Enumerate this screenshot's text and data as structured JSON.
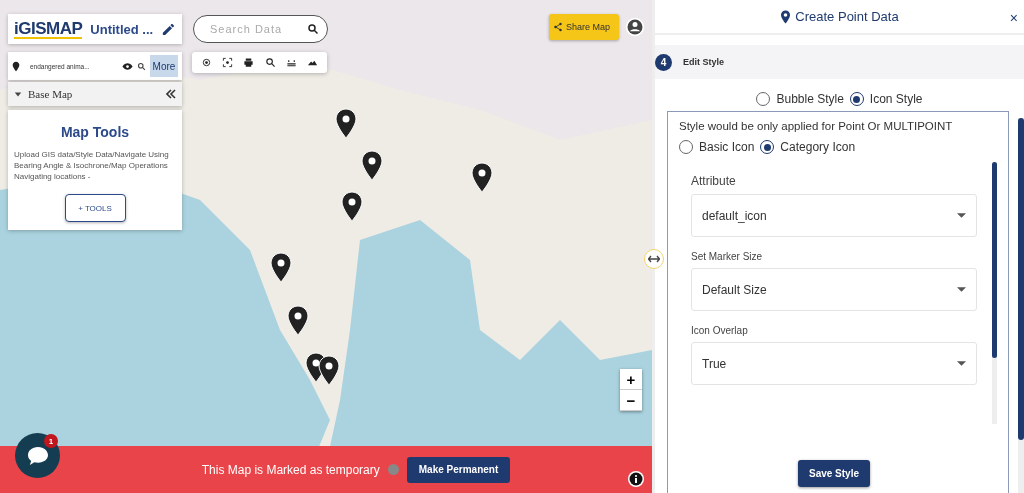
{
  "header": {
    "logo": "iGISMAP",
    "title": "Untitled ..."
  },
  "search": {
    "placeholder": "Search Data"
  },
  "layer": {
    "name": "endangered anima...",
    "more": "More"
  },
  "base_map": {
    "label": "Base Map",
    "expanded": true
  },
  "map_tools": {
    "title": "Map Tools",
    "description": "Upload GIS data/Style Data/Navigate Using Bearing Angle & Isochrone/Map Operations Navigating locations -",
    "button": "+ TOOLS"
  },
  "share_button": "Share Map",
  "zoom": {
    "in": "+",
    "out": "−"
  },
  "banner": {
    "text": "This Map is Marked as temporary",
    "button": "Make Permanent"
  },
  "chat": {
    "badge": "1"
  },
  "panel": {
    "title": "Create Point Data",
    "close": "×",
    "step": {
      "number": "4",
      "label": "Edit Style"
    },
    "style_options": [
      {
        "label": "Bubble Style",
        "selected": false
      },
      {
        "label": "Icon Style",
        "selected": true
      }
    ],
    "note": "Style would be only applied for Point Or MULTIPOINT",
    "icon_options": [
      {
        "label": "Basic Icon",
        "selected": false
      },
      {
        "label": "Category Icon",
        "selected": true
      }
    ],
    "fields": [
      {
        "label": "Attribute",
        "value": "default_icon"
      },
      {
        "label": "Set Marker Size",
        "value": "Default Size"
      },
      {
        "label": "Icon Overlap",
        "value": "True"
      }
    ],
    "save_button": "Save Style"
  }
}
